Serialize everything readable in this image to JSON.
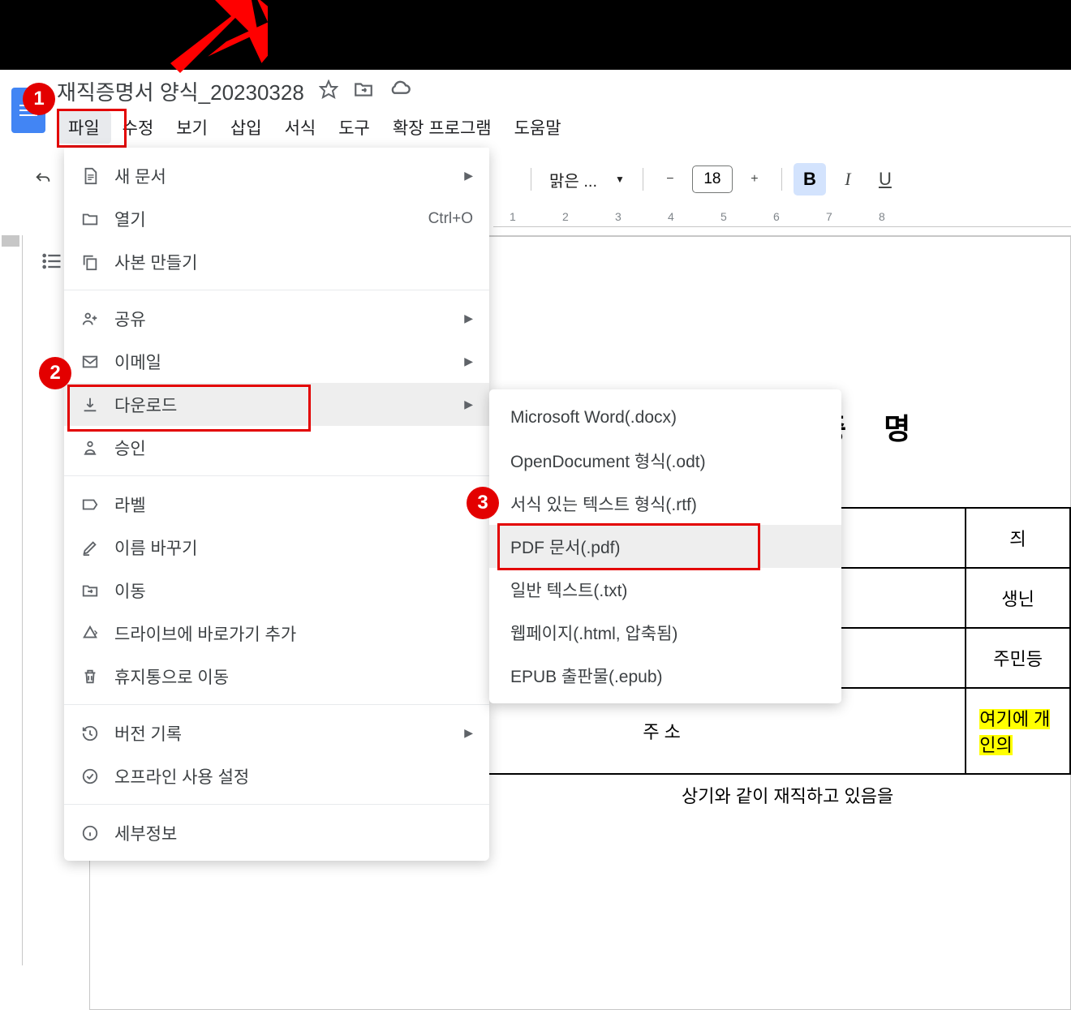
{
  "document": {
    "title": "재직증명서 양식_20230328",
    "heading_fragment": "증 명",
    "table": {
      "row1_right_fragment": "즤",
      "row2_right_fragment": "생닌",
      "row3_right_fragment": "주민등",
      "address_label": "주 소",
      "address_value_fragment": "여기에 개인의"
    },
    "caption_fragment": "상기와 같이 재직하고 있음을"
  },
  "menubar": {
    "file": "파일",
    "edit": "수정",
    "view": "보기",
    "insert": "삽입",
    "format": "서식",
    "tools": "도구",
    "extensions": "확장 프로그램",
    "help": "도움말"
  },
  "toolbar": {
    "font_name": "맑은 ...",
    "font_size": "18"
  },
  "ruler_marks": [
    "1",
    "2",
    "3",
    "4",
    "5",
    "6",
    "7",
    "8"
  ],
  "file_menu": {
    "new": "새 문서",
    "open": "열기",
    "open_shortcut": "Ctrl+O",
    "copy": "사본 만들기",
    "share": "공유",
    "email": "이메일",
    "download": "다운로드",
    "approve": "승인",
    "labels": "라벨",
    "rename": "이름 바꾸기",
    "move": "이동",
    "shortcut": "드라이브에 바로가기 추가",
    "trash": "휴지통으로 이동",
    "version": "버전 기록",
    "offline": "오프라인 사용 설정",
    "details": "세부정보"
  },
  "download_menu": {
    "docx": "Microsoft Word(.docx)",
    "odt": "OpenDocument 형식(.odt)",
    "rtf": "서식 있는 텍스트 형식(.rtf)",
    "pdf": "PDF 문서(.pdf)",
    "txt": "일반 텍스트(.txt)",
    "html": "웹페이지(.html, 압축됨)",
    "epub": "EPUB 출판물(.epub)"
  },
  "badges": {
    "b1": "1",
    "b2": "2",
    "b3": "3"
  }
}
